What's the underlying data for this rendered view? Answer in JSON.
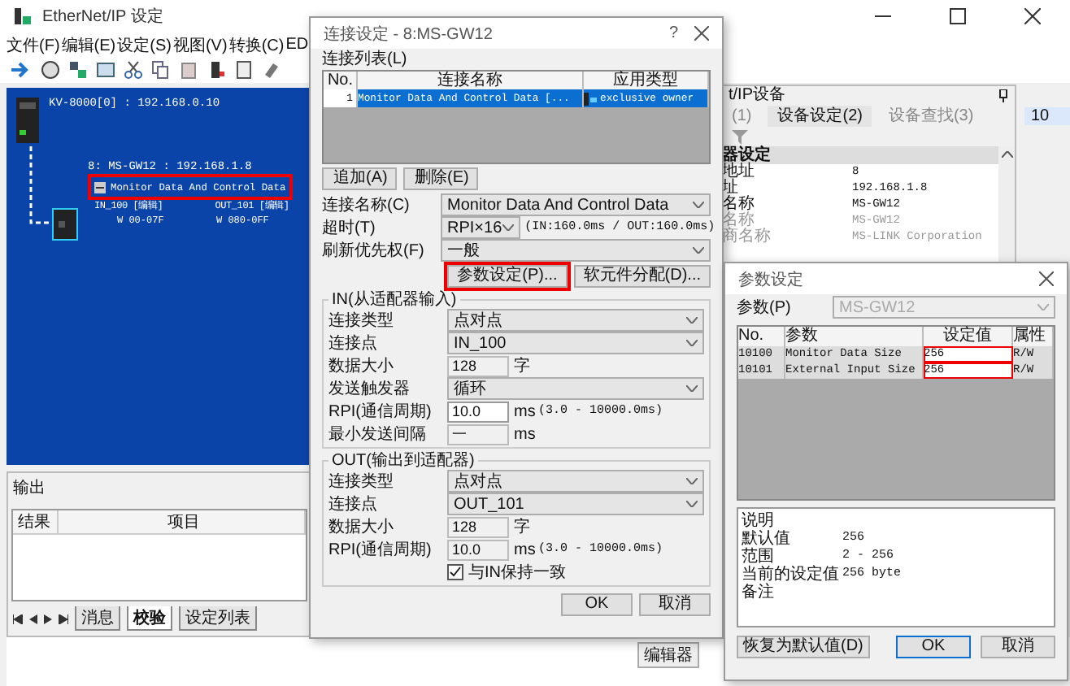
{
  "main_window": {
    "title": "EtherNet/IP 设定",
    "menu": [
      "文件(F)",
      "编辑(E)",
      "设定(S)",
      "视图(V)",
      "转换(C)",
      "ED"
    ]
  },
  "network_view": {
    "controller": "KV-8000[0] : 192.168.0.10",
    "device": "8: MS-GW12 : 192.168.1.8",
    "connection": "Monitor Data And Control Data",
    "highlighted": true,
    "in_point": "IN_100 [编辑]",
    "out_point": "OUT_101 [编辑]",
    "in_range": "W  00-07F",
    "out_range": "W  080-0FF"
  },
  "output_panel": {
    "title": "输出",
    "columns": [
      "结果",
      "项目"
    ],
    "tabs": [
      {
        "label": "消息",
        "selected": false
      },
      {
        "label": "校验",
        "selected": true
      },
      {
        "label": "设定列表",
        "selected": false
      }
    ]
  },
  "editor_tab": "编辑器",
  "grid_cell": "10",
  "device_panel": {
    "title": "t/IP设备",
    "tabs": [
      {
        "label": "(1)",
        "selected": false
      },
      {
        "label": "设备设定(2)",
        "selected": true
      },
      {
        "label": "设备查找(3)",
        "selected": false
      }
    ],
    "section": "器设定",
    "properties": [
      {
        "name": "地址",
        "value": "8",
        "disabled": false
      },
      {
        "name": "址",
        "value": "192.168.1.8",
        "disabled": false
      },
      {
        "name": "名称",
        "value": "MS-GW12",
        "disabled": false
      },
      {
        "name": "名称",
        "value": "MS-GW12",
        "disabled": true
      },
      {
        "name": "商名称",
        "value": "MS-LINK Corporation",
        "disabled": true
      }
    ]
  },
  "connection_dialog": {
    "title": "连接设定 - 8:MS-GW12",
    "help": "?",
    "list_label": "连接列表(L)",
    "columns": [
      "No.",
      "连接名称",
      "应用类型"
    ],
    "rows": [
      {
        "no": "1",
        "name": "Monitor Data And Control Data [...",
        "type": "exclusive owner",
        "selected": true
      }
    ],
    "list_buttons": [
      "追加(A)",
      "删除(E)"
    ],
    "general": [
      {
        "label": "连接名称(C)",
        "kind": "select",
        "value": "Monitor Data And Control Data"
      },
      {
        "label": "超时(T)",
        "kind": "small-select",
        "value": "RPI×16",
        "note": "(IN:160.0ms / OUT:160.0ms)"
      },
      {
        "label": "刷新优先权(F)",
        "kind": "select",
        "value": "一般"
      }
    ],
    "action_buttons": [
      {
        "label": "参数设定(P)...",
        "highlighted": true
      },
      {
        "label": "软元件分配(D)...",
        "highlighted": false
      }
    ],
    "groups": [
      {
        "title": "IN(从适配器输入)",
        "rows": [
          {
            "label": "连接类型",
            "kind": "select",
            "value": "点对点"
          },
          {
            "label": "连接点",
            "kind": "select",
            "value": "IN_100"
          },
          {
            "label": "数据大小",
            "kind": "input",
            "value": "128",
            "disabled": true,
            "unit": "字"
          },
          {
            "label": "发送触发器",
            "kind": "select",
            "value": "循环"
          },
          {
            "label": "RPI(通信周期)",
            "kind": "input",
            "value": "10.0",
            "disabled": false,
            "unit": "ms",
            "note": "(3.0 - 10000.0ms)"
          },
          {
            "label": "最小发送间隔",
            "kind": "input",
            "value": "一",
            "disabled": true,
            "unit": "ms"
          }
        ]
      },
      {
        "title": "OUT(输出到适配器)",
        "rows": [
          {
            "label": "连接类型",
            "kind": "select",
            "value": "点对点"
          },
          {
            "label": "连接点",
            "kind": "select",
            "value": "OUT_101"
          },
          {
            "label": "数据大小",
            "kind": "input",
            "value": "128",
            "disabled": true,
            "unit": "字"
          },
          {
            "label": "RPI(通信周期)",
            "kind": "input",
            "value": "10.0",
            "disabled": true,
            "unit": "ms",
            "note": "(3.0 - 10000.0ms)"
          },
          {
            "label": "与IN保持一致",
            "kind": "checkbox",
            "checked": true
          }
        ]
      }
    ],
    "buttons": [
      "OK",
      "取消"
    ]
  },
  "parameter_dialog": {
    "title": "参数设定",
    "param_label": "参数(P)",
    "device": "MS-GW12",
    "columns": [
      "No.",
      "参数",
      "设定值",
      "属性"
    ],
    "values_highlighted": true,
    "rows": [
      {
        "no": "10100",
        "name": "Monitor Data Size",
        "value": "256",
        "attr": "R/W"
      },
      {
        "no": "10101",
        "name": "External Input Size",
        "value": "256",
        "attr": "R/W"
      }
    ],
    "description": [
      {
        "label": "说明"
      },
      {
        "label": "默认值",
        "value": "256"
      },
      {
        "label": "范围",
        "value": "2 - 256"
      },
      {
        "label": "当前的设定值",
        "value": "256 byte"
      },
      {
        "label": "备注"
      }
    ],
    "buttons": [
      {
        "label": "恢复为默认值(D)",
        "default": false
      },
      {
        "label": "OK",
        "default": true
      },
      {
        "label": "取消",
        "default": false
      }
    ]
  }
}
